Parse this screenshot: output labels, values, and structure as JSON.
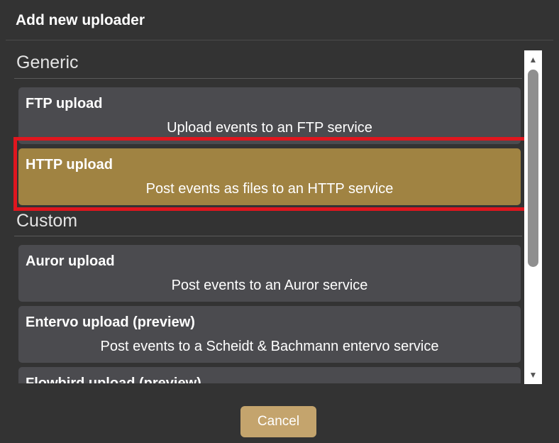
{
  "dialog": {
    "title": "Add new uploader",
    "cancel_label": "Cancel"
  },
  "sections": [
    {
      "header": "Generic",
      "items": [
        {
          "title": "FTP upload",
          "description": "Upload events to an FTP service",
          "selected": false
        },
        {
          "title": "HTTP upload",
          "description": "Post events as files to an HTTP service",
          "selected": true
        }
      ]
    },
    {
      "header": "Custom",
      "items": [
        {
          "title": "Auror upload",
          "description": "Post events to an Auror service",
          "selected": false
        },
        {
          "title": "Entervo upload (preview)",
          "description": "Post events to a Scheidt & Bachmann entervo service",
          "selected": false
        },
        {
          "title": "Flowbird upload (preview)",
          "description": "",
          "selected": false
        }
      ]
    }
  ],
  "colors": {
    "background": "#333333",
    "card": "#4b4b4f",
    "selected_card": "#a08342",
    "highlight": "#e0161e",
    "button": "#c4a46d"
  },
  "icons": {
    "scroll_up": "triangle-up-icon",
    "scroll_down": "triangle-down-icon"
  }
}
